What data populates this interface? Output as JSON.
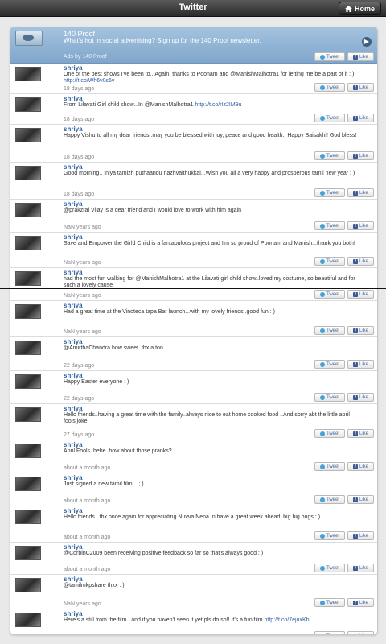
{
  "topbar": {
    "title": "Twitter",
    "home_label": "Home"
  },
  "ad": {
    "title": "140 Proof",
    "text": "What's hot in social advertising? Sign up for the 140 Proof newsletter.",
    "byline": "Ads by 140 Proof",
    "tweet_label": "Tweet",
    "like_label": "Like"
  },
  "posts": [
    {
      "name": "shriya",
      "text": "One of the best shows I've been to...Again, thanks to Poonam and @ManishMalhotra1 for letting me be a part of it : )",
      "link": "http://t.co/Wh6v0s6v",
      "time": "18 days ago"
    },
    {
      "name": "shriya",
      "text": "From Lilavati Girl child show...In @ManishMalhotra1",
      "link": "http://t.co/rIz2IM9u",
      "time": "18 days ago"
    },
    {
      "name": "shriya",
      "text": "Happy Vishu to all my dear friends..may you be blessed with joy, peace and good health.. Happy Baisakhi! God bless!",
      "link": "",
      "time": "18 days ago"
    },
    {
      "name": "shriya",
      "text": "Good morning.. Iniya tamizh puthaandu nazhvalthukkal...Wish you all a very happy and prosperous tamil new year : )",
      "link": "",
      "time": "18 days ago"
    },
    {
      "name": "shriya",
      "text": "@prakzrai Vijay is a dear friend and I would love to work with him again",
      "link": "",
      "time": "NaN years ago"
    },
    {
      "name": "shriya",
      "text": "Save and Empower the Girld Child is a fantabulous project and I'm so proud of Poonam and Manish...thank you both!",
      "link": "",
      "time": "NaN years ago"
    },
    {
      "name": "shriya",
      "text": "had the most fun walking for @ManishMalhotra1 at the Lilavati girl child show..loved my costume, so beautiful and for such a lovely cause",
      "link": "",
      "time": "NaN years ago"
    },
    {
      "name": "shriya",
      "text": "Had a great time at the Vinoteca tapa Bar launch...with my lovely friends..good fun : )",
      "link": "",
      "time": "NaN years ago"
    },
    {
      "name": "shriya",
      "text": "@AmirthaChandra how sweet..thx a ton",
      "link": "",
      "time": "22 days ago"
    },
    {
      "name": "shriya",
      "text": "Happy Easter everyone : )",
      "link": "",
      "time": "22 days ago"
    },
    {
      "name": "shriya",
      "text": "Hello friends..having a great time with the family..always nice to eat home cooked food ..And sorry abt the little april fools joke",
      "link": "",
      "time": "27 days ago"
    },
    {
      "name": "shriya",
      "text": "April Fools..hehe..how about those pranks?",
      "link": "",
      "time": "about a month ago"
    },
    {
      "name": "shriya",
      "text": "Just signed a new tamil film... ; )",
      "link": "",
      "time": "about a month ago"
    },
    {
      "name": "shriya",
      "text": "Hello friends...thx once again for appreciating Nuvva Nena..n have a great week ahead..big big hugs : )",
      "link": "",
      "time": "about a month ago"
    },
    {
      "name": "shriya",
      "text": "@CorbinC2009 been receiving positive feedback so far so that's always good : )",
      "link": "",
      "time": "about a month ago"
    },
    {
      "name": "shriya",
      "text": "@tamilmkpshare thxx : )",
      "link": "",
      "time": "NaN years ago"
    },
    {
      "name": "shriya",
      "text": "Here's a still from the film...and if you haven't seen it yet pls do so!! It's a fun film",
      "link": "http://t.co/7ejuxKb",
      "time": "NaN years ago"
    }
  ],
  "buttons": {
    "tweet": "Tweet",
    "like": "Like"
  }
}
